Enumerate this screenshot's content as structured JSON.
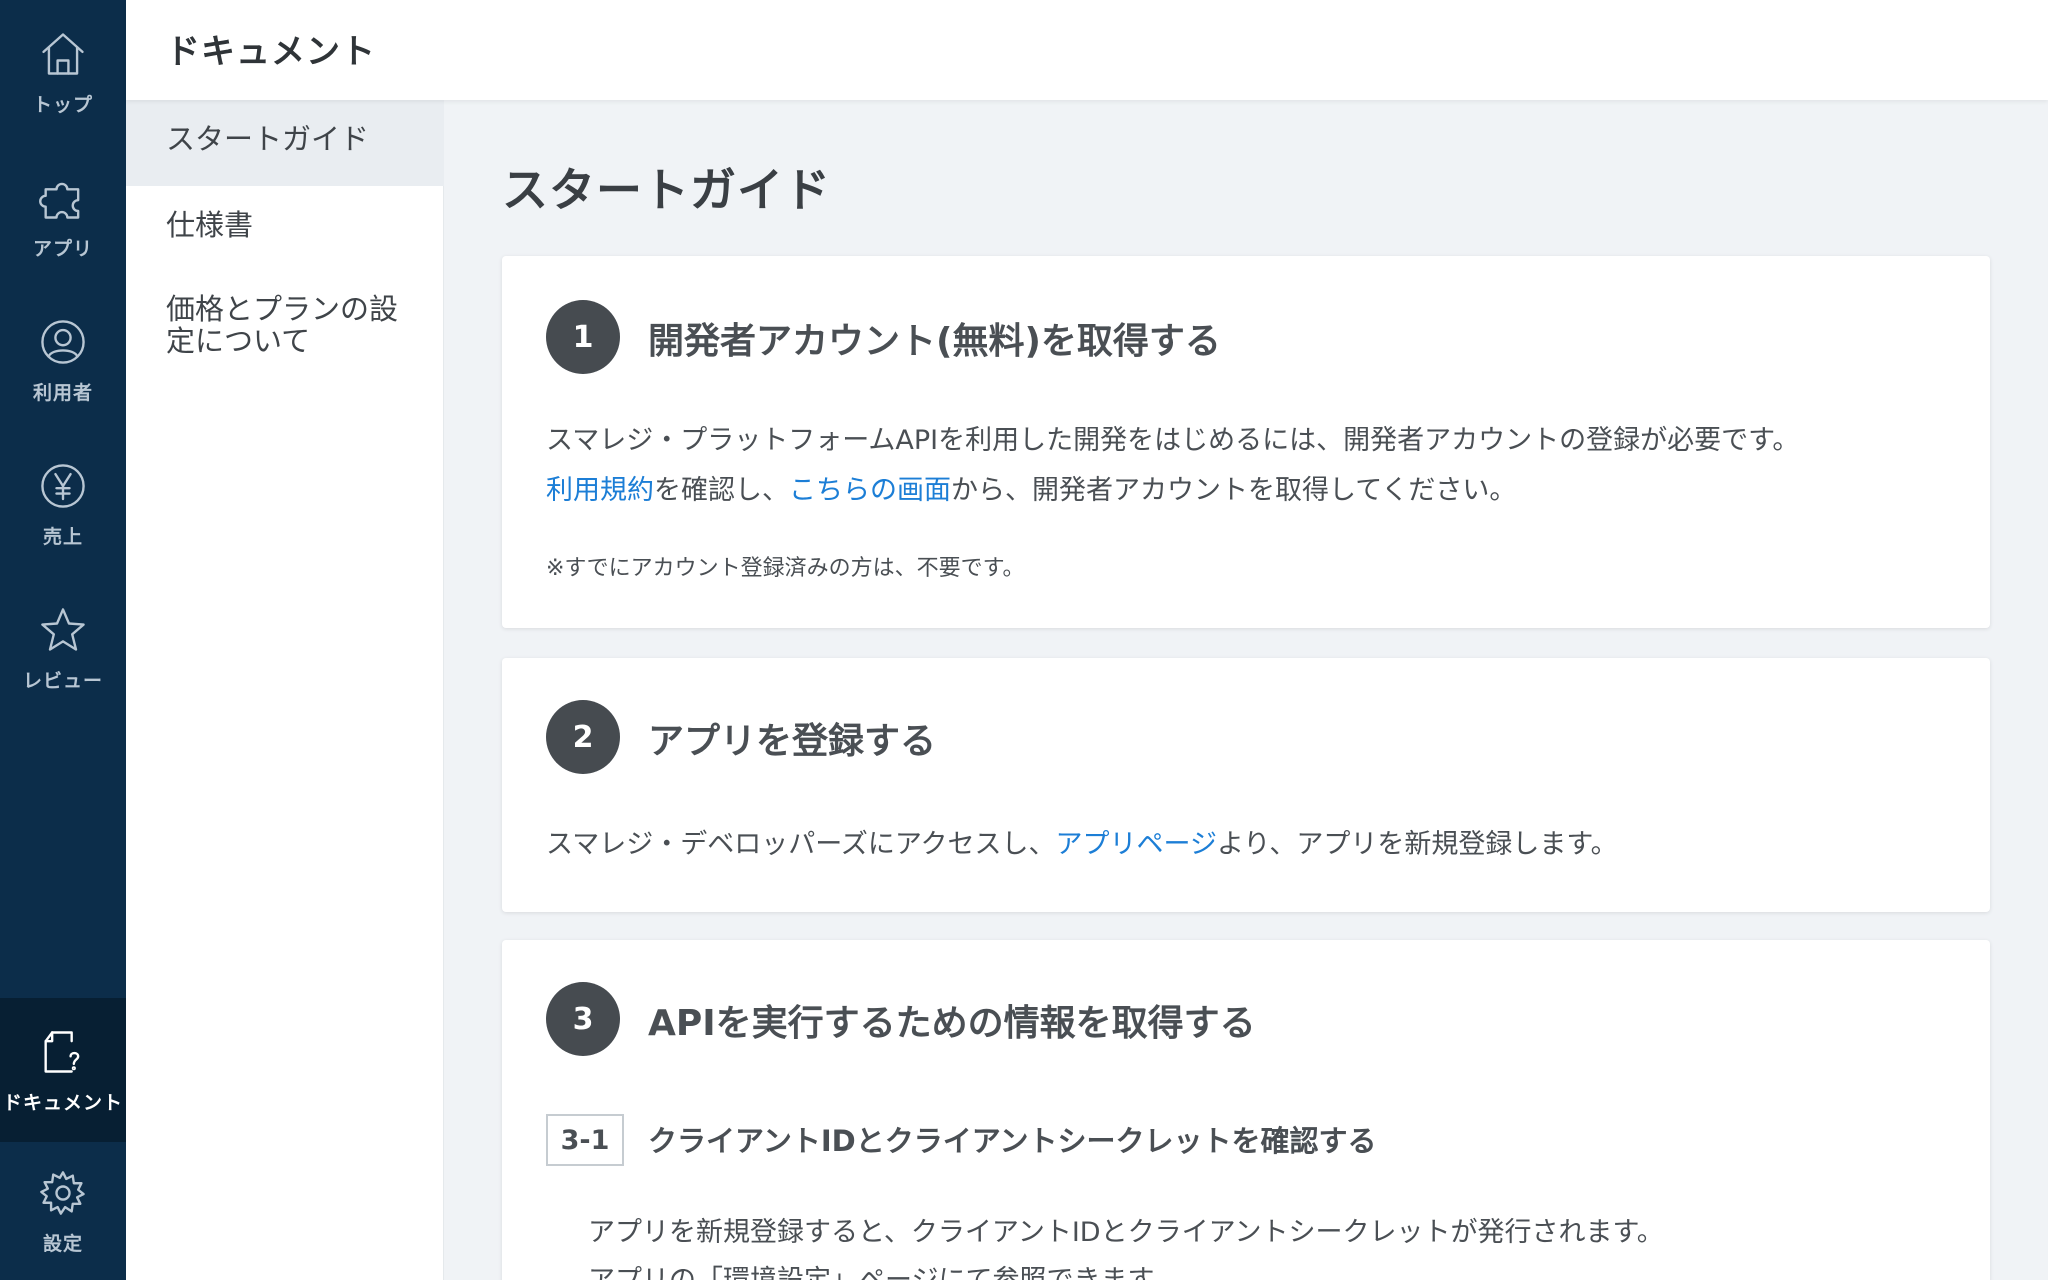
{
  "rail": {
    "items": [
      {
        "label": "トップ",
        "icon": "home-icon"
      },
      {
        "label": "アプリ",
        "icon": "puzzle-icon"
      },
      {
        "label": "利用者",
        "icon": "user-icon"
      },
      {
        "label": "売上",
        "icon": "yen-icon"
      },
      {
        "label": "レビュー",
        "icon": "star-icon"
      },
      {
        "label": "ドキュメント",
        "icon": "document-help-icon",
        "active": true
      },
      {
        "label": "設定",
        "icon": "gear-icon"
      }
    ]
  },
  "header": {
    "title": "ドキュメント"
  },
  "subnav": {
    "items": [
      {
        "label": "スタートガイド",
        "active": true
      },
      {
        "label": "仕様書"
      },
      {
        "label": "価格とプランの設定について"
      }
    ]
  },
  "main": {
    "title": "スタートガイド",
    "step1": {
      "num": "1",
      "title": "開発者アカウント(無料)を取得する",
      "line1": "スマレジ・プラットフォームAPIを利用した開発をはじめるには、開発者アカウントの登録が必要です。",
      "line2_link1": "利用規約",
      "line2_mid": "を確認し、",
      "line2_link2": "こちらの画面",
      "line2_end": "から、開発者アカウントを取得してください。",
      "note": "※すでにアカウント登録済みの方は、不要です。"
    },
    "step2": {
      "num": "2",
      "title": "アプリを登録する",
      "text_pre": "スマレジ・デベロッパーズにアクセスし、",
      "link": "アプリページ",
      "text_post": "より、アプリを新規登録します。"
    },
    "step3": {
      "num": "3",
      "title": "APIを実行するための情報を取得する",
      "sub_num": "3-1",
      "sub_title": "クライアントIDとクライアントシークレットを確認する",
      "line1": "アプリを新規登録すると、クライアントIDとクライアントシークレットが発行されます。",
      "line2": "アプリの「環境設定」ページにて参照できます。"
    }
  },
  "colors": {
    "rail_bg": "#0c2d4a",
    "rail_active_bg": "#071f33",
    "link": "#1c7ed6",
    "step_circle": "#464b50"
  }
}
